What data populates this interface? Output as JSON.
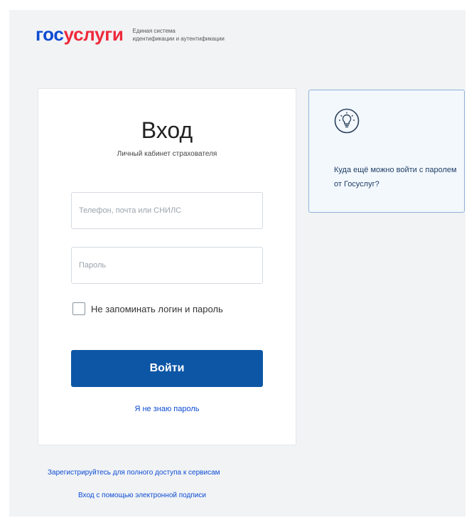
{
  "header": {
    "logo_part1": "гос",
    "logo_part2": "услуги",
    "logo_subtitle_line1": "Единая система",
    "logo_subtitle_line2": "идентификации и аутентификации"
  },
  "login": {
    "title": "Вход",
    "subtitle": "Личный кабинет страхователя",
    "login_placeholder": "Телефон, почта или СНИЛС",
    "password_placeholder": "Пароль",
    "remember_label": "Не запоминать логин и пароль",
    "submit_label": "Войти",
    "forgot_label": "Я не знаю пароль"
  },
  "info": {
    "icon": "lightbulb-icon",
    "text": "Куда ещё можно войти с паролем от Госуслуг?"
  },
  "footer": {
    "register_link": "Зарегистрируйтесь для полного доступа к сервисам",
    "esign_link": "Вход с помощью электронной подписи"
  },
  "colors": {
    "brand_blue": "#0d4cd3",
    "brand_red": "#ee2a3b",
    "button_blue": "#0d56a6",
    "page_bg": "#f1f3f5"
  }
}
